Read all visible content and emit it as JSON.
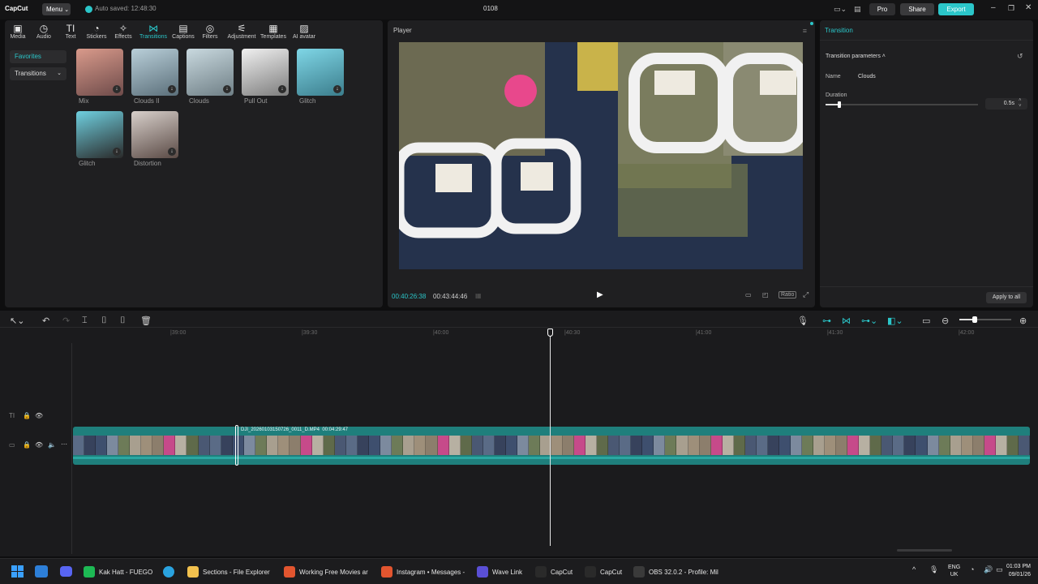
{
  "app": {
    "logo": "CapCut",
    "menu_label": "Menu",
    "autosave": "Auto saved: 12:48:30",
    "project_name": "0108"
  },
  "titlebar": {
    "pro_label": "Pro",
    "share_label": "Share",
    "export_label": "Export"
  },
  "tabs": [
    {
      "label": "Media",
      "icon": "media-icon"
    },
    {
      "label": "Audio",
      "icon": "audio-icon"
    },
    {
      "label": "Text",
      "icon": "text-icon"
    },
    {
      "label": "Stickers",
      "icon": "stickers-icon"
    },
    {
      "label": "Effects",
      "icon": "effects-icon"
    },
    {
      "label": "Transitions",
      "icon": "transitions-icon",
      "active": true
    },
    {
      "label": "Captions",
      "icon": "captions-icon"
    },
    {
      "label": "Filters",
      "icon": "filters-icon"
    },
    {
      "label": "Adjustment",
      "icon": "adjustment-icon"
    },
    {
      "label": "Templates",
      "icon": "templates-icon"
    },
    {
      "label": "AI avatar",
      "icon": "ai-avatar-icon"
    }
  ],
  "sidebar": {
    "favorites": "Favorites",
    "transitions": "Transitions"
  },
  "transitions_grid": [
    {
      "label": "Mix",
      "color_a": "#d99a8b",
      "color_b": "#6e4b4a"
    },
    {
      "label": "Clouds II",
      "color_a": "#b9cfd9",
      "color_b": "#5b6f7a"
    },
    {
      "label": "Clouds",
      "color_a": "#c9d9df",
      "color_b": "#6f7f86"
    },
    {
      "label": "Pull Out",
      "color_a": "#f0f0f0",
      "color_b": "#7d7d7d"
    },
    {
      "label": "Glitch",
      "color_a": "#7fd6e6",
      "color_b": "#3b7d8c"
    },
    {
      "label": "Glitch",
      "color_a": "#6fd0e0",
      "color_b": "#2a2a2a"
    },
    {
      "label": "Distortion",
      "color_a": "#d8d0cb",
      "color_b": "#5a4a45"
    }
  ],
  "player": {
    "title": "Player",
    "current_time": "00:40:26:38",
    "total_time": "00:43:44:46",
    "ratio_label": "Ratio"
  },
  "right_panel": {
    "title": "Transition",
    "section": "Transition parameters",
    "name_label": "Name",
    "name_value": "Clouds",
    "duration_label": "Duration",
    "duration_value": "0.5s",
    "duration_fraction": 0.09,
    "apply_all": "Apply to all"
  },
  "timeline": {
    "ruler": [
      "|39:00",
      "|39:30",
      "|40:00",
      "|40:30",
      "|41:00",
      "|41:30",
      "|42:00"
    ],
    "clip_name": "DJI_20260103150726_0011_D.MP4",
    "clip_duration": "00:04:29:47",
    "zoom_fraction": 0.3
  },
  "taskbar": {
    "items": [
      {
        "label": "Kak Hatt - FUEGO",
        "icon": "spotify-icon",
        "color": "#1db954"
      },
      {
        "label": "Sections - File Explorer",
        "icon": "folder-icon",
        "color": "#f2c14e"
      },
      {
        "label": "Working Free Movies ar",
        "icon": "brave-icon",
        "color": "#e2552f"
      },
      {
        "label": "Instagram • Messages -",
        "icon": "brave-icon",
        "color": "#e2552f"
      },
      {
        "label": "Wave Link",
        "icon": "wave-link-icon",
        "color": "#5a4fd6"
      },
      {
        "label": "CapCut",
        "icon": "capcut-icon",
        "color": "#2a2a2a"
      },
      {
        "label": "CapCut",
        "icon": "capcut-icon",
        "color": "#2a2a2a"
      },
      {
        "label": "OBS 32.0.2 - Profile: Mil",
        "icon": "obs-icon",
        "color": "#3a3a3a"
      }
    ],
    "lang": "ENG",
    "region": "UK",
    "time": "01:03 PM",
    "date": "09/01/26"
  },
  "colors": {
    "accent": "#2bc6c9",
    "track": "#1f7f7c",
    "panel": "#1f1f21"
  }
}
